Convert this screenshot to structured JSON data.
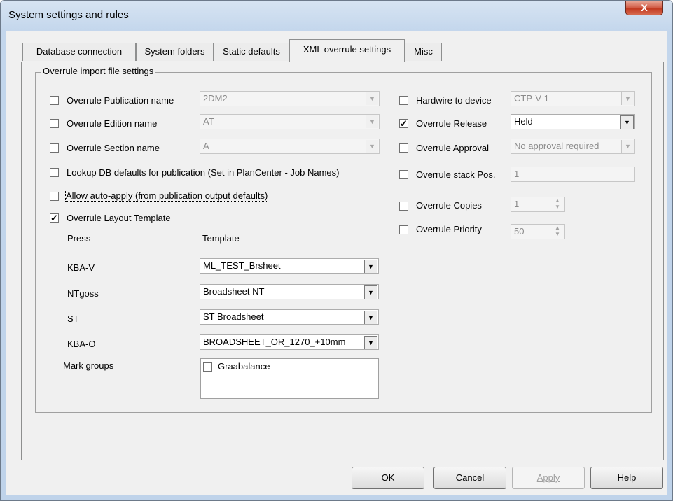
{
  "window": {
    "title": "System settings and rules",
    "close_glyph": "X"
  },
  "tabs": [
    {
      "label": "Database connection",
      "active": false
    },
    {
      "label": "System folders",
      "active": false
    },
    {
      "label": "Static defaults",
      "active": false
    },
    {
      "label": "XML overrule settings",
      "active": true
    },
    {
      "label": "Misc",
      "active": false
    }
  ],
  "group": {
    "title": "Overrule import file settings"
  },
  "left": {
    "publication": {
      "label": "Overrule Publication name",
      "checked": false,
      "value": "2DM2"
    },
    "edition": {
      "label": "Overrule Edition name",
      "checked": false,
      "value": "AT"
    },
    "section": {
      "label": "Overrule Section name",
      "checked": false,
      "value": "A"
    },
    "lookup": {
      "label": "Lookup DB defaults for publication (Set in PlanCenter - Job Names)",
      "checked": false
    },
    "autoapply": {
      "label": "Allow auto-apply (from publication output defaults)",
      "checked": false
    },
    "layout": {
      "label": "Overrule Layout Template",
      "checked": true,
      "check_glyph": "✓"
    }
  },
  "template_table": {
    "col_press": "Press",
    "col_template": "Template",
    "rows": [
      {
        "press": "KBA-V",
        "template": "ML_TEST_Brsheet"
      },
      {
        "press": "NTgoss",
        "template": "Broadsheet NT"
      },
      {
        "press": "ST",
        "template": "ST Broadsheet"
      },
      {
        "press": "KBA-O",
        "template": "BROADSHEET_OR_1270_+10mm"
      }
    ],
    "mark_groups_label": "Mark groups",
    "mark_groups": [
      {
        "label": "Graabalance",
        "checked": false
      }
    ]
  },
  "right": {
    "hardwire": {
      "label": "Hardwire to device",
      "checked": false,
      "value": "CTP-V-1"
    },
    "release": {
      "label": "Overrule Release",
      "checked": true,
      "value": "Held"
    },
    "approval": {
      "label": "Overrule Approval",
      "checked": false,
      "value": "No approval required"
    },
    "stack": {
      "label": "Overrule stack Pos.",
      "checked": false,
      "value": "1"
    },
    "copies": {
      "label": "Overrule Copies",
      "checked": false,
      "value": "1"
    },
    "priority": {
      "label": "Overrule Priority",
      "checked": false,
      "value": "50"
    }
  },
  "buttons": {
    "ok": "OK",
    "cancel": "Cancel",
    "apply": "Apply",
    "help": "Help"
  },
  "icons": {
    "dropdown": "▼",
    "spin_up": "▲",
    "spin_down": "▼",
    "check": "✓"
  }
}
